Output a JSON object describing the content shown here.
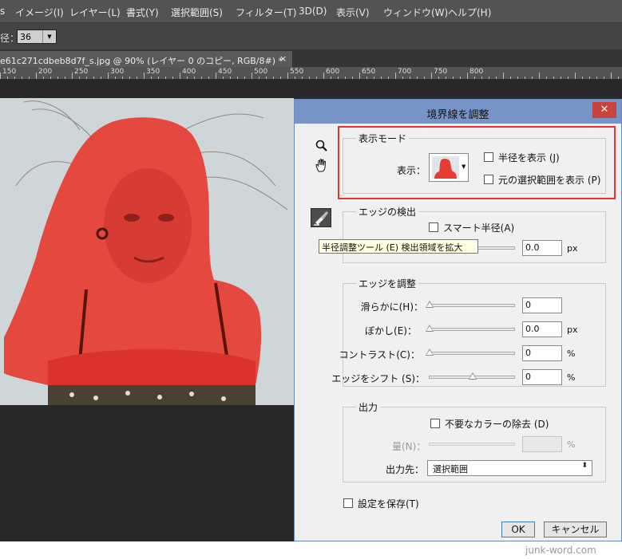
{
  "menu": [
    "イメージ(I)",
    "レイヤー(L)",
    "書式(Y)",
    "選択範囲(S)",
    "フィルター(T)",
    "3D(D)",
    "表示(V)",
    "ウィンドウ(W)",
    "ヘルプ(H)"
  ],
  "options": {
    "label": "径：",
    "brush_size": "36"
  },
  "document_tab": {
    "title": "e61c271cdbeb8d7f_s.jpg @ 90% (レイヤー 0 のコピー, RGB/8#) *",
    "close": "×"
  },
  "ruler": [
    "150",
    "200",
    "250",
    "300",
    "350",
    "400",
    "450",
    "500",
    "550",
    "600",
    "650",
    "700",
    "750",
    "800"
  ],
  "dialog": {
    "title": "境界線を調整",
    "close": "✕",
    "view_mode": {
      "title": "表示モード",
      "view_label": "表示：",
      "show_radius": "半径を表示 (J)",
      "show_original": "元の選択範囲を表示 (P)"
    },
    "edge_detection": {
      "title": "エッジの検出",
      "smart_radius": "スマート半径(A)",
      "radius_value": "0.0",
      "radius_unit": "px",
      "tooltip": "半径調整ツール (E) 検出領域を拡大"
    },
    "adjust_edge": {
      "title": "エッジを調整",
      "rows": [
        {
          "label": "滑らかに(H)：",
          "value": "0",
          "unit": "",
          "level": 0
        },
        {
          "label": "ぼかし(E)：",
          "value": "0.0",
          "unit": "px",
          "level": 0
        },
        {
          "label": "コントラスト(C)：",
          "value": "0",
          "unit": "%",
          "level": 0
        },
        {
          "label": "エッジをシフト (S)：",
          "value": "0",
          "unit": "%",
          "level": 0.5
        }
      ]
    },
    "output": {
      "title": "出力",
      "decontaminate": "不要なカラーの除去 (D)",
      "amount_label": "量(N)：",
      "amount_unit": "%",
      "output_to_label": "出力先：",
      "output_to_value": "選択範囲"
    },
    "remember": "設定を保存(T)",
    "ok": "OK",
    "cancel": "キャンセル"
  },
  "watermark": "junk-word.com",
  "colors": {
    "highlight": "#e8302f",
    "titlebar": "#7694c6",
    "overlay": "#e63c32"
  }
}
